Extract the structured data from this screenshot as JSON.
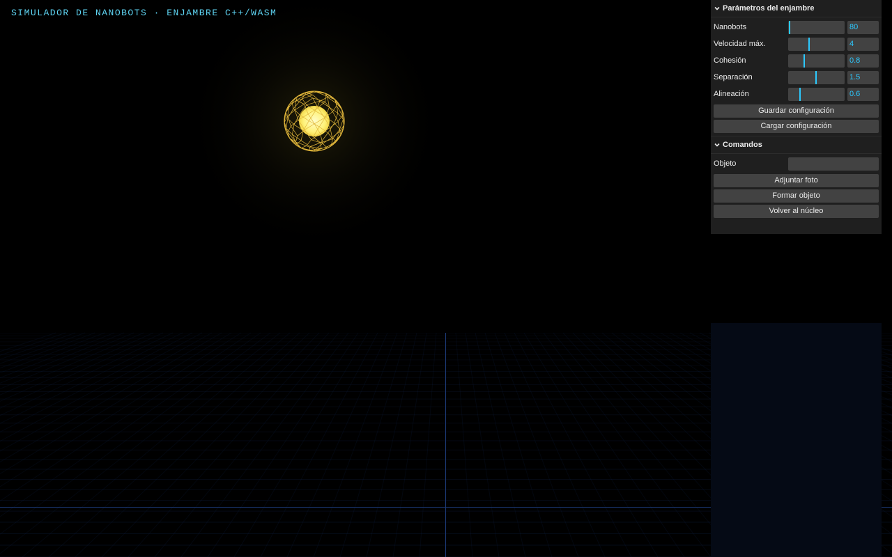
{
  "app": {
    "title": "SIMULADOR DE NANOBOTS · ENJAMBRE C++/WASM"
  },
  "colors": {
    "title": "#5fd6f5",
    "accent": "#2cc9ff",
    "panel_bg": "#1f1f1f",
    "control_bg": "#424242",
    "swarm_core": "#fff8a0",
    "swarm_wire": "#e0b53a",
    "grid": "#1c3a78"
  },
  "swarm_panel": {
    "title": "Parámetros del enjambre",
    "controls": [
      {
        "label": "Nanobots",
        "value": "80",
        "fraction": 0.0
      },
      {
        "label": "Velocidad máx.",
        "value": "4",
        "fraction": 0.35
      },
      {
        "label": "Cohesión",
        "value": "0.8",
        "fraction": 0.26
      },
      {
        "label": "Separación",
        "value": "1.5",
        "fraction": 0.48
      },
      {
        "label": "Alineación",
        "value": "0.6",
        "fraction": 0.19
      }
    ],
    "save_label": "Guardar configuración",
    "load_label": "Cargar configuración"
  },
  "commands_panel": {
    "title": "Comandos",
    "object_label": "Objeto",
    "object_value": "",
    "attach_label": "Adjuntar foto",
    "form_label": "Formar objeto",
    "return_label": "Volver al núcleo"
  }
}
